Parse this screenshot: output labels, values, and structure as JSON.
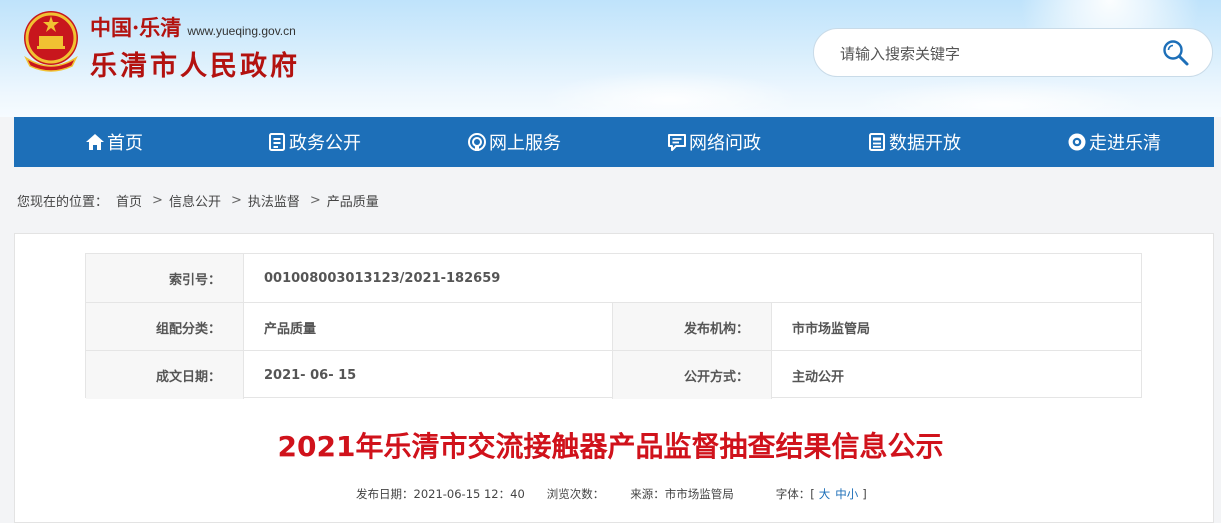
{
  "header": {
    "site_prefix": "中国·乐清",
    "url_text": "www.yueqing.gov.cn",
    "site_name": "乐清市人民政府",
    "search_placeholder": "请输入搜索关键字"
  },
  "nav": {
    "items": [
      {
        "label": "首页",
        "icon": "home-icon"
      },
      {
        "label": "政务公开",
        "icon": "document-icon"
      },
      {
        "label": "网上服务",
        "icon": "service-icon"
      },
      {
        "label": "网络问政",
        "icon": "message-icon"
      },
      {
        "label": "数据开放",
        "icon": "data-icon"
      },
      {
        "label": "走进乐清",
        "icon": "eye-icon"
      }
    ]
  },
  "breadcrumb": {
    "prefix": "您现在的位置：",
    "items": [
      "首页",
      "信息公开",
      "执法监督",
      "产品质量"
    ],
    "separator": ">"
  },
  "meta": {
    "index_label": "索引号：",
    "index_value": "001008003013123/2021-182659",
    "category_label": "组配分类：",
    "category_value": "产品质量",
    "publisher_label": "发布机构：",
    "publisher_value": "市市场监管局",
    "date_label": "成文日期：",
    "date_value": "2021- 06- 15",
    "open_label": "公开方式：",
    "open_value": "主动公开"
  },
  "article": {
    "title": "2021年乐清市交流接触器产品监督抽查结果信息公示",
    "publish_label": "发布日期：",
    "publish_value": "2021-06-15 12：40",
    "views_label": "浏览次数：",
    "source_label": "来源：",
    "source_value": "市市场监管局",
    "font_label": "字体：",
    "font_open": "[",
    "font_large": "大",
    "font_medium": "中",
    "font_small": "小",
    "font_close": "]"
  },
  "colors": {
    "nav_bg": "#1d6fb8",
    "brand_red": "#b3120f",
    "title_red": "#d0121b"
  }
}
